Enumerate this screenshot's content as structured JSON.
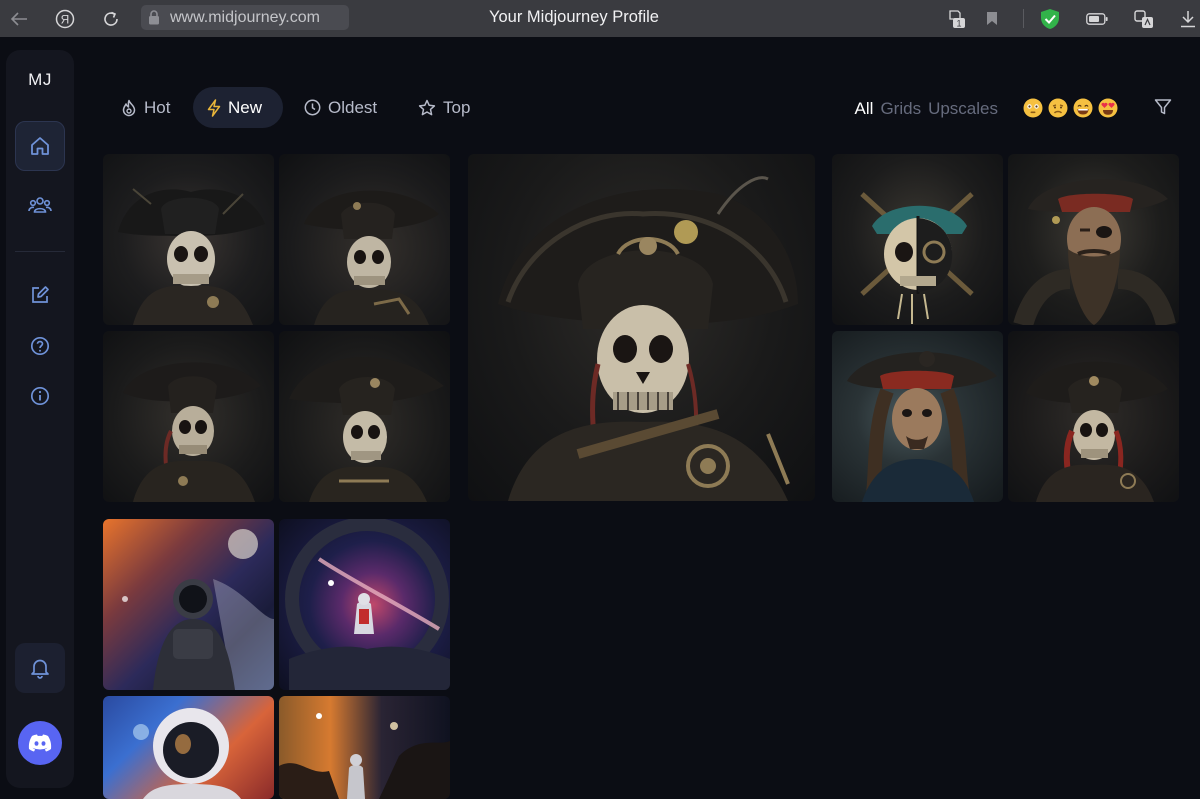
{
  "browser": {
    "url": "www.midjourney.com",
    "title": "Your Midjourney Profile",
    "tab_badge": "1",
    "icons": [
      "back-icon",
      "yandex-icon",
      "reload-icon",
      "lock-icon",
      "tabs-icon",
      "bookmark-icon",
      "shield-icon",
      "battery-icon",
      "translate-icon",
      "download-icon"
    ]
  },
  "sidebar": {
    "logo": "MJ",
    "items": [
      {
        "name": "home",
        "icon": "home-icon",
        "active": true
      },
      {
        "name": "community",
        "icon": "users-icon",
        "active": false
      },
      {
        "name": "edit",
        "icon": "edit-icon",
        "active": false
      },
      {
        "name": "help",
        "icon": "help-icon",
        "active": false
      },
      {
        "name": "info",
        "icon": "info-icon",
        "active": false
      },
      {
        "name": "notifications",
        "icon": "bell-icon",
        "active": false
      },
      {
        "name": "discord",
        "icon": "discord-icon",
        "active": false
      }
    ]
  },
  "sort_tabs": [
    {
      "label": "Hot",
      "icon": "flame-icon",
      "active": false
    },
    {
      "label": "New",
      "icon": "bolt-icon",
      "active": true
    },
    {
      "label": "Oldest",
      "icon": "clock-icon",
      "active": false
    },
    {
      "label": "Top",
      "icon": "star-icon",
      "active": false
    }
  ],
  "type_filters": [
    {
      "label": "All",
      "active": true
    },
    {
      "label": "Grids",
      "active": false
    },
    {
      "label": "Upscales",
      "active": false
    }
  ],
  "reactions": [
    "flushed-emoji",
    "frowning-emoji",
    "grinning-emoji",
    "heart-eyes-emoji"
  ],
  "colors": {
    "background": "#0b0d14",
    "sidebar": "#14161f",
    "accent": "#5865f2",
    "icon_blue": "#6f92d8",
    "active_tab": "#1d2232"
  },
  "gallery": {
    "pirate_grid": [
      "pirate-skeleton-1",
      "pirate-skeleton-2",
      "pirate-skeleton-3",
      "pirate-skeleton-4"
    ],
    "pirate_upscale": "pirate-skeleton-large",
    "pirate_grid_2": [
      "pirate-skull-split",
      "bearded-pirate",
      "jack-sparrow-pirate",
      "pirate-skeleton-red"
    ],
    "space_grid": [
      "astronaut-nebula",
      "astronaut-portal",
      "astronaut-helmet-colorful",
      "astronaut-orange-sky"
    ]
  }
}
